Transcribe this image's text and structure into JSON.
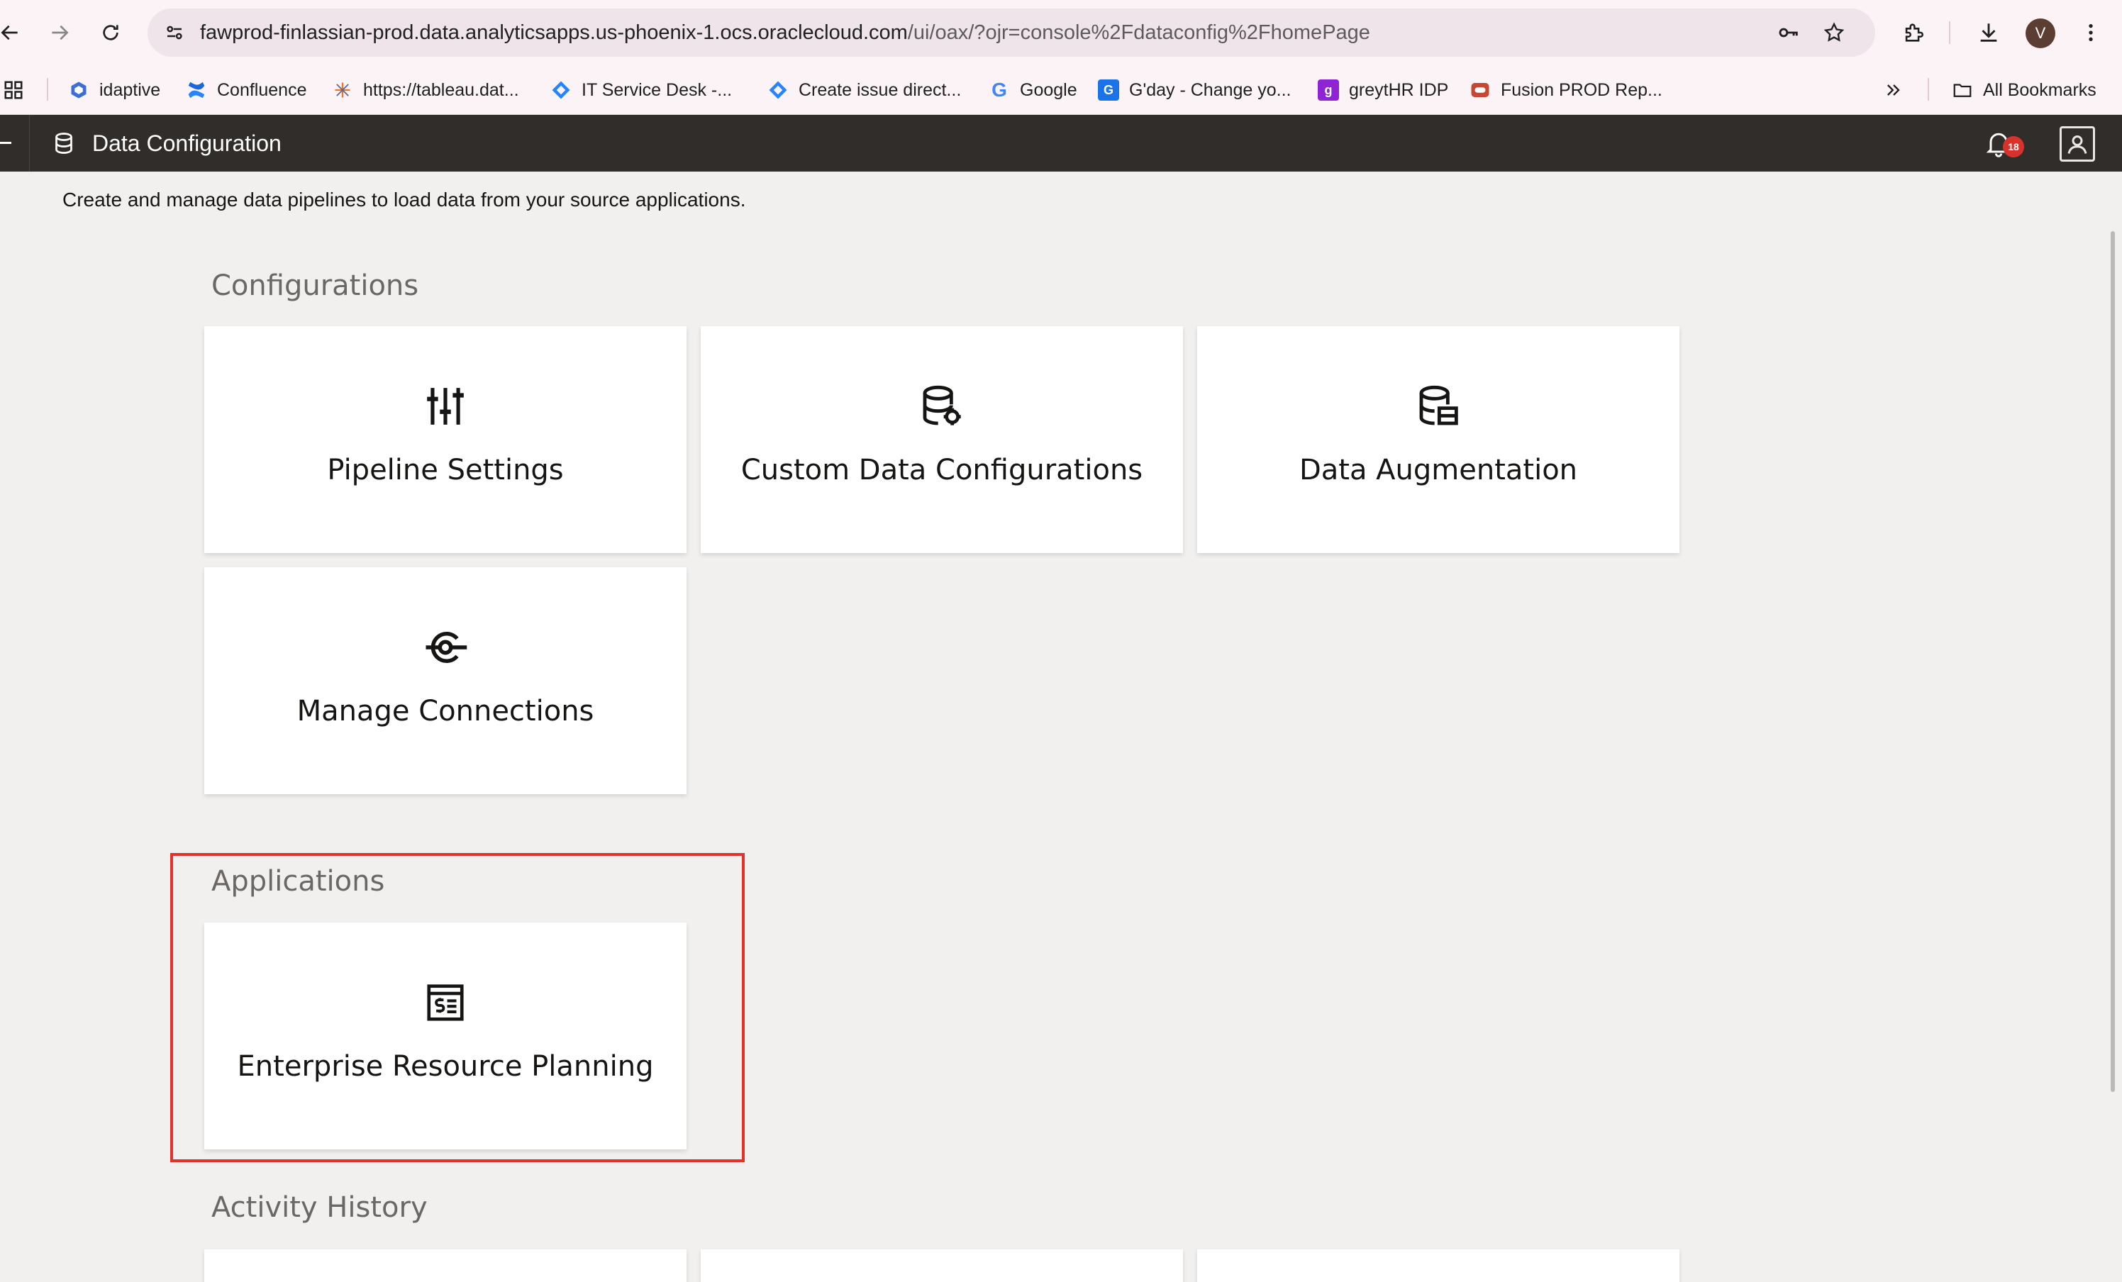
{
  "browser": {
    "url_host": "fawprod-finlassian-prod.data.analyticsapps.us-phoenix-1.ocs.oraclecloud.com",
    "url_path": "/ui/oax/?ojr=console%2Fdataconfig%2FhomePage",
    "avatar_letter": "V",
    "bookmarks": [
      {
        "label": "idaptive",
        "icon": "idaptive-icon"
      },
      {
        "label": "Confluence",
        "icon": "confluence-icon"
      },
      {
        "label": "https://tableau.dat...",
        "icon": "tableau-icon"
      },
      {
        "label": "IT Service Desk -...",
        "icon": "jira-icon"
      },
      {
        "label": "Create issue direct...",
        "icon": "jira-icon"
      },
      {
        "label": "Google",
        "icon": "google-icon"
      },
      {
        "label": "G'day - Change yo...",
        "icon": "gday-icon"
      },
      {
        "label": "greytHR IDP",
        "icon": "greythr-icon"
      },
      {
        "label": "Fusion PROD Rep...",
        "icon": "oracle-icon"
      }
    ],
    "all_bookmarks_label": "All Bookmarks"
  },
  "app": {
    "title": "Data Configuration",
    "notification_count": "18"
  },
  "page": {
    "subtitle": "Create and manage data pipelines to load data from your source applications.",
    "sections": {
      "configurations": {
        "title": "Configurations",
        "cards": [
          {
            "label": "Pipeline Settings",
            "icon": "sliders-icon"
          },
          {
            "label": "Custom Data Configurations",
            "icon": "database-gear-icon"
          },
          {
            "label": "Data Augmentation",
            "icon": "database-table-icon"
          },
          {
            "label": "Manage Connections",
            "icon": "connection-icon"
          }
        ]
      },
      "applications": {
        "title": "Applications",
        "cards": [
          {
            "label": "Enterprise Resource Planning",
            "icon": "erp-ledger-icon"
          }
        ]
      },
      "activity_history": {
        "title": "Activity History"
      }
    }
  },
  "colors": {
    "header_bg": "#312d2a",
    "page_bg": "#f1f0ef",
    "highlight": "#e2322a",
    "badge": "#d7322b"
  }
}
